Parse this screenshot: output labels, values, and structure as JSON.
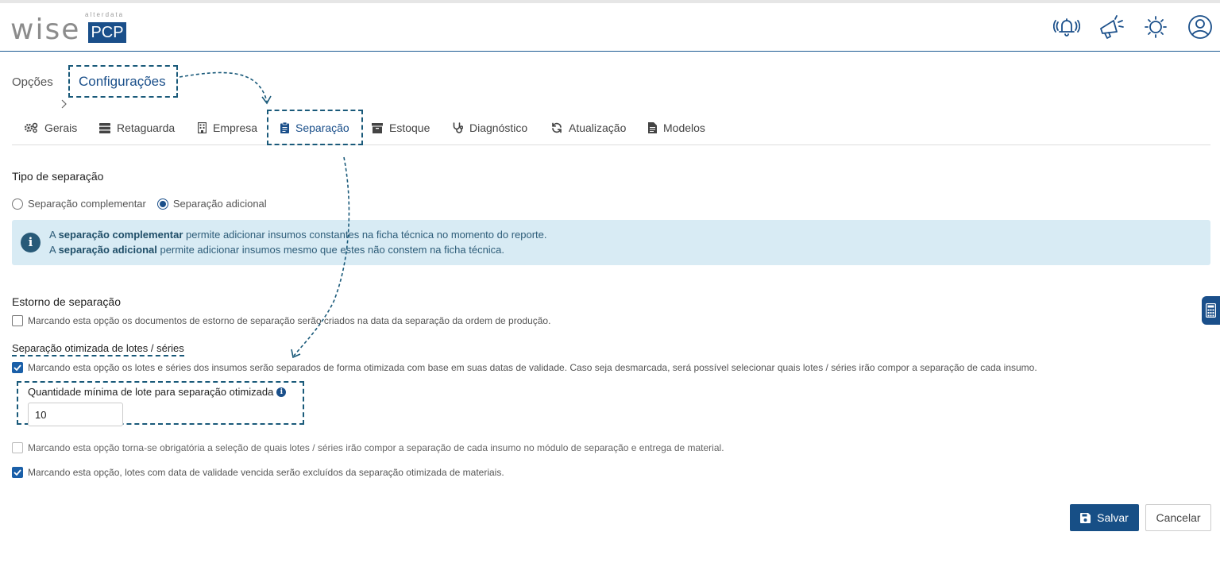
{
  "brand": {
    "small": "alterdata",
    "name": "wise",
    "badge": "PCP"
  },
  "header": {
    "icons": [
      "bell-icon",
      "megaphone-icon",
      "sun-icon",
      "user-icon"
    ]
  },
  "breadcrumb": {
    "parent": "Opções",
    "current": "Configurações"
  },
  "tabs": [
    {
      "label": "Gerais",
      "icon": "gears-icon"
    },
    {
      "label": "Retaguarda",
      "icon": "server-icon"
    },
    {
      "label": "Empresa",
      "icon": "building-icon"
    },
    {
      "label": "Separação",
      "icon": "clipboard-icon",
      "active": true
    },
    {
      "label": "Estoque",
      "icon": "archive-icon"
    },
    {
      "label": "Diagnóstico",
      "icon": "stethoscope-icon"
    },
    {
      "label": "Atualização",
      "icon": "refresh-icon"
    },
    {
      "label": "Modelos",
      "icon": "document-icon"
    }
  ],
  "tipo": {
    "title": "Tipo de separação",
    "options": [
      {
        "label": "Separação complementar",
        "checked": false
      },
      {
        "label": "Separação adicional",
        "checked": true
      }
    ],
    "info": {
      "line1_pre": "A ",
      "line1_bold": "separação complementar",
      "line1_post": " permite adicionar insumos constantes na ficha técnica no momento do reporte.",
      "line2_pre": "A ",
      "line2_bold": "separação adicional",
      "line2_post": " permite adicionar insumos mesmo que estes não constem na ficha técnica."
    }
  },
  "estorno": {
    "title": "Estorno de separação",
    "option": {
      "label": "Marcando esta opção os documentos de estorno de separação serão criados na data da separação da ordem de produção.",
      "checked": false
    }
  },
  "lotes": {
    "title": "Separação otimizada de lotes / séries",
    "option": {
      "label": "Marcando esta opção os lotes e séries dos insumos serão separados de forma otimizada com base em suas datas de validade. Caso seja desmarcada, será possível selecionar quais lotes / séries irão compor a separação de cada insumo.",
      "checked": true
    },
    "quantidade_label": "Quantidade mínima de lote para separação otimizada",
    "quantidade_value": "10",
    "obrigatoria": {
      "label": "Marcando esta opção torna-se obrigatória a seleção de quais lotes / séries irão compor a separação de cada insumo no módulo de separação e entrega de material.",
      "checked": false,
      "disabled": true
    },
    "vencidos": {
      "label": "Marcando esta opção, lotes com data de validade vencida serão excluídos da separação otimizada de materiais.",
      "checked": true
    }
  },
  "actions": {
    "save": "Salvar",
    "cancel": "Cancelar"
  },
  "colors": {
    "primary": "#1a4f8a",
    "info_bg": "#d8ebf4",
    "annotation": "#1a5a7a"
  }
}
